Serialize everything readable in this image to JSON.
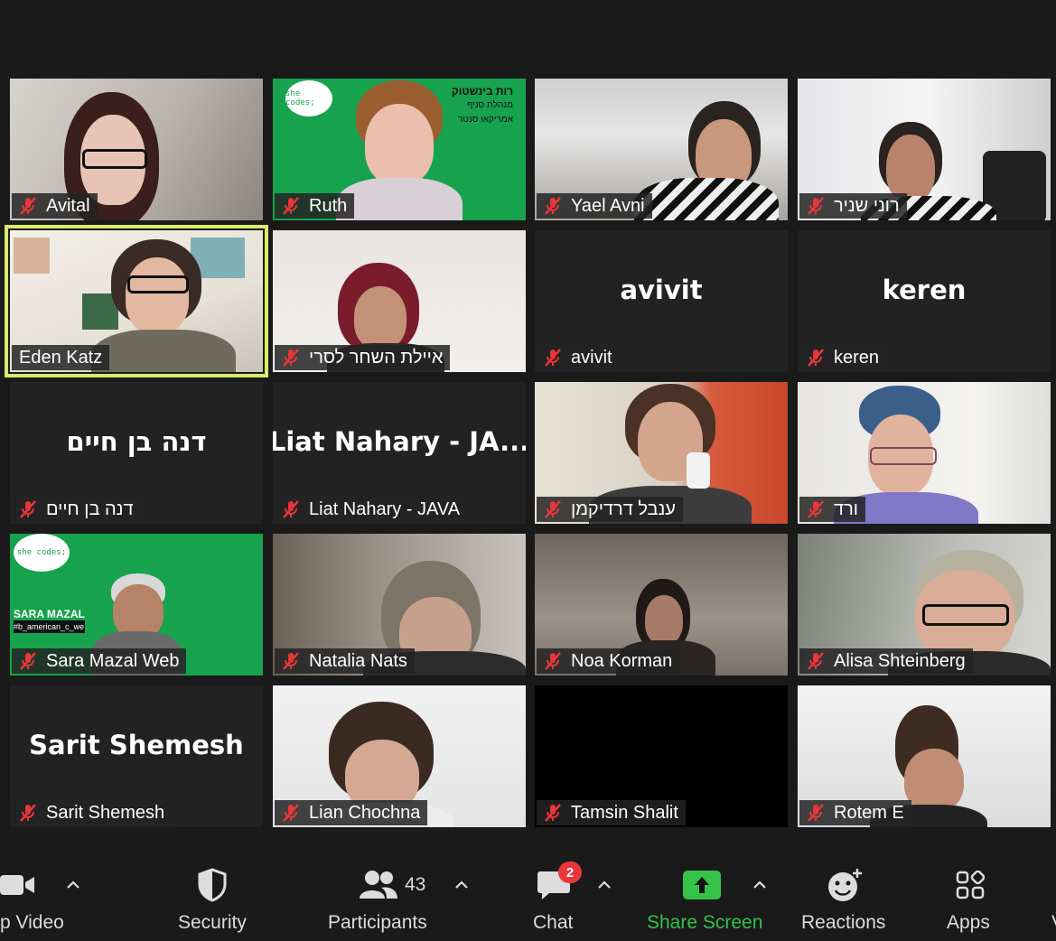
{
  "participants": [
    {
      "name": "Avital"
    },
    {
      "name": "Ruth",
      "banner": {
        "line1": "רות בינשטוק",
        "line2": "מנהלת סניף",
        "line3": "אמריקאו סנטר"
      },
      "logo": "she codes;"
    },
    {
      "name": "Yael Avni"
    },
    {
      "name": "רוני שניר"
    },
    {
      "name": "Eden Katz"
    },
    {
      "name": "איילת השחר לסרי"
    },
    {
      "name": "avivit",
      "display": "avivit"
    },
    {
      "name": "keren",
      "display": "keren"
    },
    {
      "name": "דנה בן חיים",
      "display": "דנה בן חיים"
    },
    {
      "name": "Liat Nahary - JAVA",
      "display": "Liat Nahary - JA..."
    },
    {
      "name": "ענבל דרדיקמן"
    },
    {
      "name": "ורד"
    },
    {
      "name": "Sara Mazal Web",
      "logo": "she codes;",
      "banner": {
        "line1": "SARA MAZAL",
        "line2": "#b_american_c_we"
      }
    },
    {
      "name": "Natalia Nats"
    },
    {
      "name": "Noa Korman"
    },
    {
      "name": "Alisa Shteinberg"
    },
    {
      "name": "Sarit Shemesh",
      "display": "Sarit Shemesh"
    },
    {
      "name": "Lian Chochna"
    },
    {
      "name": "Tamsin Shalit"
    },
    {
      "name": "Rotem E"
    }
  ],
  "toolbar": {
    "video_label": "p Video",
    "security_label": "Security",
    "participants_label": "Participants",
    "participants_count": "43",
    "chat_label": "Chat",
    "chat_badge": "2",
    "share_label": "Share Screen",
    "reactions_label": "Reactions",
    "apps_label": "Apps",
    "more_label": "V"
  },
  "colors": {
    "background": "#1a1a1a",
    "active_speaker_border": "#d8ec6c",
    "mute_icon": "#e8363a",
    "share_green": "#34c24b",
    "badge_red": "#e8363a"
  },
  "icons": [
    "video-camera-icon",
    "shield-icon",
    "participants-icon",
    "chat-bubble-icon",
    "share-screen-icon",
    "reactions-icon",
    "apps-icon",
    "muted-mic-icon",
    "caret-up-icon"
  ]
}
